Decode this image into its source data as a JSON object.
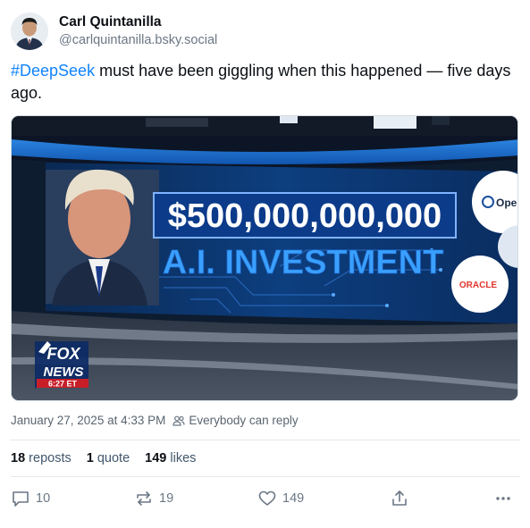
{
  "author": {
    "name": "Carl Quintanilla",
    "handle": "@carlquintanilla.bsky.social"
  },
  "post": {
    "hashtag": "#DeepSeek",
    "text": " must have been giggling when this happened — five days ago."
  },
  "media": {
    "headline": "$500,000,000,000",
    "subheadline": "A.I. INVESTMENT",
    "logo_openai": "Oper",
    "logo_oracle": "ORACLE",
    "network_logo_top": "FOX",
    "network_logo_bottom": "NEWS",
    "timestamp": "6:27 ET"
  },
  "meta": {
    "datetime": "January 27, 2025 at 4:33 PM",
    "reply_setting": "Everybody can reply"
  },
  "stats": {
    "reposts_count": "18",
    "reposts_label": "reposts",
    "quotes_count": "1",
    "quotes_label": "quote",
    "likes_count": "149",
    "likes_label": "likes"
  },
  "actions": {
    "reply_count": "10",
    "repost_count": "19",
    "like_count": "149"
  },
  "colors": {
    "link": "#1083fe",
    "muted": "#6b7785",
    "text": "#0b0f14"
  }
}
